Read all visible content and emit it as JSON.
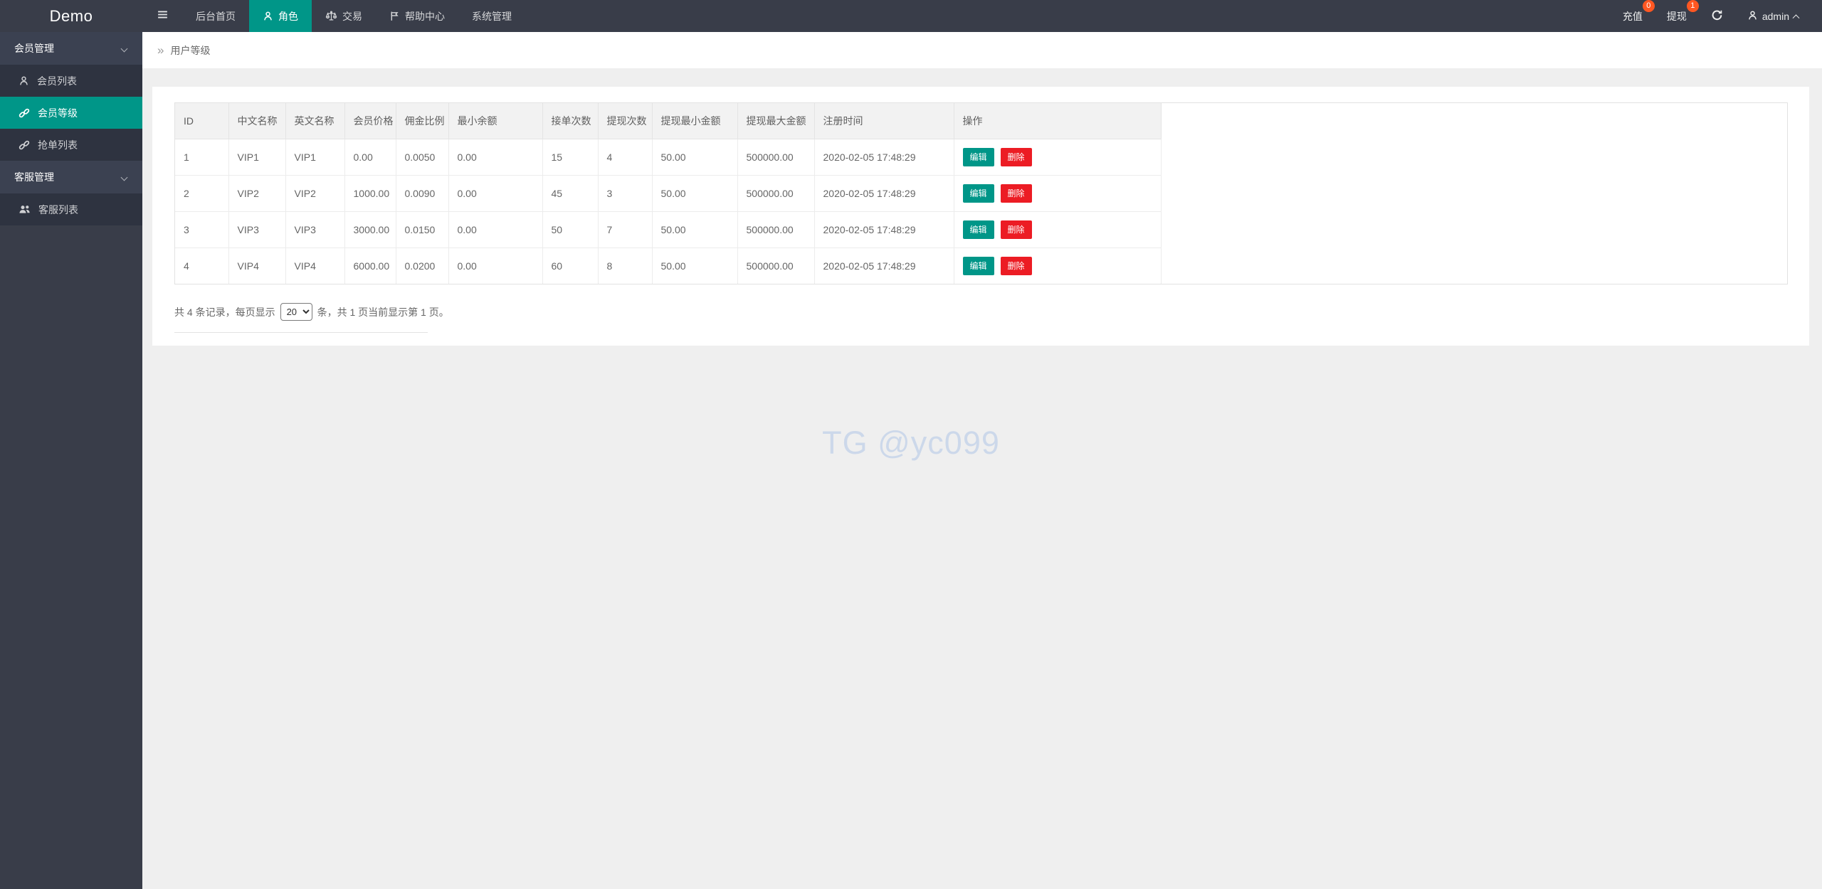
{
  "topbar": {
    "logo": "Demo",
    "nav": [
      {
        "label": "后台首页",
        "icon": "none",
        "active": false
      },
      {
        "label": "角色",
        "icon": "person-icon",
        "active": true
      },
      {
        "label": "交易",
        "icon": "scales-icon",
        "active": false
      },
      {
        "label": "帮助中心",
        "icon": "flag-icon",
        "active": false
      },
      {
        "label": "系统管理",
        "icon": "none",
        "active": false
      }
    ],
    "right": {
      "recharge": {
        "label": "充值",
        "badge": "0"
      },
      "withdraw": {
        "label": "提现",
        "badge": "1"
      },
      "refresh_icon": "refresh-icon",
      "user": {
        "name": "admin",
        "icon": "person-icon"
      }
    }
  },
  "sidebar": {
    "groups": [
      {
        "label": "会员管理",
        "items": [
          {
            "label": "会员列表",
            "icon": "person-icon",
            "active": false
          },
          {
            "label": "会员等级",
            "icon": "link-icon",
            "active": true
          },
          {
            "label": "抢单列表",
            "icon": "link-icon",
            "active": false
          }
        ]
      },
      {
        "label": "客服管理",
        "items": [
          {
            "label": "客服列表",
            "icon": "users-icon",
            "active": false
          }
        ]
      }
    ]
  },
  "breadcrumb": {
    "icon": "»",
    "label": "用户等级"
  },
  "table": {
    "headers": [
      "ID",
      "中文名称",
      "英文名称",
      "会员价格",
      "佣金比例",
      "最小余额",
      "接单次数",
      "提现次数",
      "提现最小金额",
      "提现最大金额",
      "注册时间",
      "操作"
    ],
    "rows": [
      [
        "1",
        "VIP1",
        "VIP1",
        "0.00",
        "0.0050",
        "0.00",
        "15",
        "4",
        "50.00",
        "500000.00",
        "2020-02-05 17:48:29"
      ],
      [
        "2",
        "VIP2",
        "VIP2",
        "1000.00",
        "0.0090",
        "0.00",
        "45",
        "3",
        "50.00",
        "500000.00",
        "2020-02-05 17:48:29"
      ],
      [
        "3",
        "VIP3",
        "VIP3",
        "3000.00",
        "0.0150",
        "0.00",
        "50",
        "7",
        "50.00",
        "500000.00",
        "2020-02-05 17:48:29"
      ],
      [
        "4",
        "VIP4",
        "VIP4",
        "6000.00",
        "0.0200",
        "0.00",
        "60",
        "8",
        "50.00",
        "500000.00",
        "2020-02-05 17:48:29"
      ]
    ],
    "actions": {
      "edit": "编辑",
      "delete": "删除"
    }
  },
  "pagination": {
    "prefix": "共 4 条记录，每页显示",
    "per_page": "20",
    "suffix": "条，共 1 页当前显示第 1 页。"
  },
  "watermark": "TG @yc099",
  "colors": {
    "topbar": "#393d49",
    "accent": "#009688",
    "danger": "#ec1c24",
    "badge": "#ff5722"
  }
}
